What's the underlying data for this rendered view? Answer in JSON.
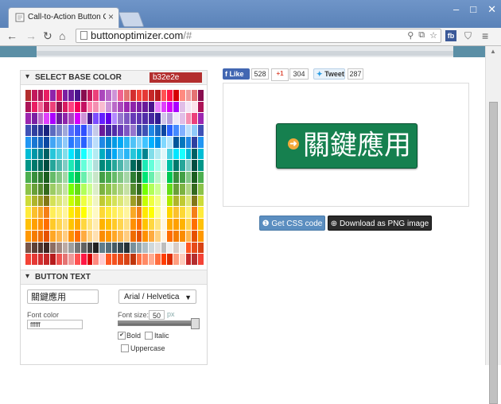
{
  "browser": {
    "tab_title": "Call-to-Action Button Ge",
    "url_host": "buttonoptimizer.com",
    "url_path": "/#",
    "ext_fb": "fb"
  },
  "color_panel": {
    "title": "SELECT BASE COLOR",
    "selected_hex": "b32e2e"
  },
  "text_panel": {
    "title": "BUTTON TEXT",
    "text_value": "關鍵應用",
    "font_family": "Arial / Helvetica",
    "font_color_label": "Font color",
    "font_color_value": "ffffff",
    "font_size_label": "Font size:",
    "font_size_value": "50",
    "font_size_unit": "px",
    "bold_label": "Bold",
    "italic_label": "Italic",
    "uppercase_label": "Uppercase"
  },
  "social": {
    "like_label": "Like",
    "like_count": "528",
    "gplus_label": "+1",
    "gplus_count": "304",
    "tweet_label": "Tweet",
    "tweet_count": "287"
  },
  "preview": {
    "button_text": "關鍵應用",
    "button_color": "#16804f"
  },
  "actions": {
    "css_label": "Get CSS code",
    "png_label": "Download as PNG image"
  },
  "palette_rows": [
    [
      "#b32e2e",
      "#c2185b",
      "#ad1457",
      "#e91e63",
      "#8e24aa",
      "#d81b60",
      "#7b1fa2",
      "#6a1b9a",
      "#4a148c",
      "#880e4f",
      "#c2185b",
      "#ec407a",
      "#ab47bc",
      "#ba68c8",
      "#ce93d8",
      "#f06292",
      "#e57373",
      "#d32f2f",
      "#f44336",
      "#e53935",
      "#c62828",
      "#b71c1c",
      "#ff5252",
      "#ff1744",
      "#d50000",
      "#ff8a80",
      "#ef9a9a",
      "#e57373",
      "#880e4f"
    ],
    [
      "#ad1457",
      "#e91e63",
      "#f06292",
      "#c2185b",
      "#ec407a",
      "#880e4f",
      "#d81b60",
      "#ff4081",
      "#f50057",
      "#c51162",
      "#ff80ab",
      "#f48fb1",
      "#f8bbd0",
      "#ce93d8",
      "#ba68c8",
      "#ab47bc",
      "#9c27b0",
      "#8e24aa",
      "#7b1fa2",
      "#6a1b9a",
      "#4a148c",
      "#ea80fc",
      "#e040fb",
      "#d500f9",
      "#aa00ff",
      "#e1bee7",
      "#f3e5f5",
      "#fce4ec",
      "#ad1457"
    ],
    [
      "#9c27b0",
      "#7b1fa2",
      "#ba68c8",
      "#e040fb",
      "#aa00ff",
      "#6a1b9a",
      "#8e24aa",
      "#ab47bc",
      "#d500f9",
      "#ce93d8",
      "#4a148c",
      "#7c4dff",
      "#651fff",
      "#6200ea",
      "#b388ff",
      "#9575cd",
      "#7e57c2",
      "#673ab7",
      "#5e35b1",
      "#512da8",
      "#4527a0",
      "#311b92",
      "#d1c4e9",
      "#b39ddb",
      "#ede7f6",
      "#e1bee7",
      "#f48fb1",
      "#ec407a",
      "#9c27b0"
    ],
    [
      "#3f51b5",
      "#303f9f",
      "#283593",
      "#1a237e",
      "#5c6bc0",
      "#7986cb",
      "#9fa8da",
      "#536dfe",
      "#3d5afe",
      "#304ffe",
      "#8c9eff",
      "#c5cae9",
      "#6a1b9a",
      "#4527a0",
      "#512da8",
      "#673ab7",
      "#7e57c2",
      "#9575cd",
      "#3949ab",
      "#3f51b5",
      "#1e88e5",
      "#1565c0",
      "#0d47a1",
      "#2962ff",
      "#448aff",
      "#82b1ff",
      "#bbdefb",
      "#90caf9",
      "#3f51b5"
    ],
    [
      "#2196f3",
      "#1976d2",
      "#1565c0",
      "#0d47a1",
      "#42a5f5",
      "#64b5f6",
      "#90caf9",
      "#2979ff",
      "#448aff",
      "#2962ff",
      "#82b1ff",
      "#bbdefb",
      "#1e88e5",
      "#0288d1",
      "#039be5",
      "#03a9f4",
      "#29b6f6",
      "#4fc3f7",
      "#81d4fa",
      "#40c4ff",
      "#00b0ff",
      "#0091ea",
      "#80d8ff",
      "#b3e5fc",
      "#01579b",
      "#0277bd",
      "#1e88e5",
      "#303f9f",
      "#2196f3"
    ],
    [
      "#00bcd4",
      "#0097a7",
      "#00838f",
      "#006064",
      "#26c6da",
      "#4dd0e1",
      "#80deea",
      "#00e5ff",
      "#00b8d4",
      "#18ffff",
      "#84ffff",
      "#b2ebf2",
      "#00acc1",
      "#0288d1",
      "#03a9f4",
      "#4fc3f7",
      "#29b6f6",
      "#26c6da",
      "#00bcd4",
      "#00838f",
      "#80deea",
      "#b2ebf2",
      "#e0f7fa",
      "#4dd0e1",
      "#00e5ff",
      "#18ffff",
      "#00b8d4",
      "#006064",
      "#00bcd4"
    ],
    [
      "#009688",
      "#00796b",
      "#00695c",
      "#004d40",
      "#26a69a",
      "#4db6ac",
      "#80cbc4",
      "#1de9b6",
      "#00bfa5",
      "#64ffda",
      "#a7ffeb",
      "#b2dfdb",
      "#00897b",
      "#009688",
      "#26a69a",
      "#4db6ac",
      "#80cbc4",
      "#00695c",
      "#004d40",
      "#1de9b6",
      "#64ffda",
      "#a7ffeb",
      "#e0f2f1",
      "#00bfa5",
      "#00796b",
      "#26a69a",
      "#80cbc4",
      "#004d40",
      "#009688"
    ],
    [
      "#4caf50",
      "#388e3c",
      "#2e7d32",
      "#1b5e20",
      "#66bb6a",
      "#81c784",
      "#a5d6a7",
      "#00e676",
      "#00c853",
      "#69f0ae",
      "#b9f6ca",
      "#c8e6c9",
      "#43a047",
      "#4caf50",
      "#66bb6a",
      "#81c784",
      "#a5d6a7",
      "#2e7d32",
      "#1b5e20",
      "#00e676",
      "#69f0ae",
      "#b9f6ca",
      "#e8f5e9",
      "#00c853",
      "#388e3c",
      "#43a047",
      "#81c784",
      "#1b5e20",
      "#4caf50"
    ],
    [
      "#8bc34a",
      "#689f38",
      "#558b2f",
      "#33691e",
      "#9ccc65",
      "#aed581",
      "#c5e1a5",
      "#76ff03",
      "#64dd17",
      "#b2ff59",
      "#ccff90",
      "#dcedc8",
      "#7cb342",
      "#8bc34a",
      "#9ccc65",
      "#aed581",
      "#c5e1a5",
      "#558b2f",
      "#33691e",
      "#76ff03",
      "#b2ff59",
      "#ccff90",
      "#f1f8e9",
      "#64dd17",
      "#689f38",
      "#7cb342",
      "#aed581",
      "#33691e",
      "#8bc34a"
    ],
    [
      "#cddc39",
      "#afb42b",
      "#9e9d24",
      "#827717",
      "#d4e157",
      "#dce775",
      "#e6ee9c",
      "#c6ff00",
      "#aeea00",
      "#eeff41",
      "#f4ff81",
      "#f0f4c3",
      "#c0ca33",
      "#cddc39",
      "#d4e157",
      "#dce775",
      "#e6ee9c",
      "#9e9d24",
      "#827717",
      "#c6ff00",
      "#eeff41",
      "#f4ff81",
      "#f9fbe7",
      "#aeea00",
      "#afb42b",
      "#c0ca33",
      "#dce775",
      "#827717",
      "#cddc39"
    ],
    [
      "#ffeb3b",
      "#fbc02d",
      "#f9a825",
      "#f57f17",
      "#ffee58",
      "#fff176",
      "#fff59d",
      "#ffea00",
      "#ffd600",
      "#ffff00",
      "#ffff8d",
      "#fff9c4",
      "#fdd835",
      "#ffeb3b",
      "#ffee58",
      "#fff176",
      "#fff59d",
      "#f9a825",
      "#f57f17",
      "#ffea00",
      "#ffff00",
      "#ffff8d",
      "#fffde7",
      "#ffd600",
      "#fbc02d",
      "#fdd835",
      "#fff176",
      "#f57f17",
      "#ffeb3b"
    ],
    [
      "#ffc107",
      "#ffa000",
      "#ff8f00",
      "#ff6f00",
      "#ffca28",
      "#ffd54f",
      "#ffe082",
      "#ffc400",
      "#ffab00",
      "#ffd740",
      "#ffe57f",
      "#ffecb3",
      "#ffb300",
      "#ffc107",
      "#ffca28",
      "#ffd54f",
      "#ffe082",
      "#ff8f00",
      "#ff6f00",
      "#ffc400",
      "#ffd740",
      "#ffe57f",
      "#fff8e1",
      "#ffab00",
      "#ffa000",
      "#ffb300",
      "#ffd54f",
      "#ff6f00",
      "#ffc107"
    ],
    [
      "#ff9800",
      "#f57c00",
      "#ef6c00",
      "#e65100",
      "#ffa726",
      "#ffb74d",
      "#ffcc80",
      "#ff9100",
      "#ff6d00",
      "#ffab40",
      "#ffd180",
      "#ffe0b2",
      "#fb8c00",
      "#ff9800",
      "#ffa726",
      "#ffb74d",
      "#ffcc80",
      "#ef6c00",
      "#e65100",
      "#ff9100",
      "#ffab40",
      "#ffd180",
      "#fff3e0",
      "#ff6d00",
      "#f57c00",
      "#fb8c00",
      "#ffb74d",
      "#e65100",
      "#ff9800"
    ],
    [
      "#795548",
      "#5d4037",
      "#4e342e",
      "#3e2723",
      "#8d6e63",
      "#a1887f",
      "#bcaaa4",
      "#9e9e9e",
      "#757575",
      "#616161",
      "#424242",
      "#212121",
      "#607d8b",
      "#546e7a",
      "#455a64",
      "#37474f",
      "#263238",
      "#78909c",
      "#90a4ae",
      "#b0bec5",
      "#cfd8dc",
      "#e0e0e0",
      "#bdbdbd",
      "#eeeeee",
      "#d7ccc8",
      "#efebe9",
      "#ff5722",
      "#e64a19",
      "#d84315"
    ],
    [
      "#f44336",
      "#e53935",
      "#d32f2f",
      "#c62828",
      "#b71c1c",
      "#ef5350",
      "#e57373",
      "#ef9a9a",
      "#ff5252",
      "#ff1744",
      "#d50000",
      "#ff8a80",
      "#ffcdd2",
      "#ff5722",
      "#f4511e",
      "#e64a19",
      "#d84315",
      "#bf360c",
      "#ff7043",
      "#ff8a65",
      "#ffab91",
      "#ff6e40",
      "#ff3d00",
      "#dd2c00",
      "#ff9e80",
      "#ffccbc",
      "#c62828",
      "#b32e2e",
      "#f44336"
    ]
  ]
}
